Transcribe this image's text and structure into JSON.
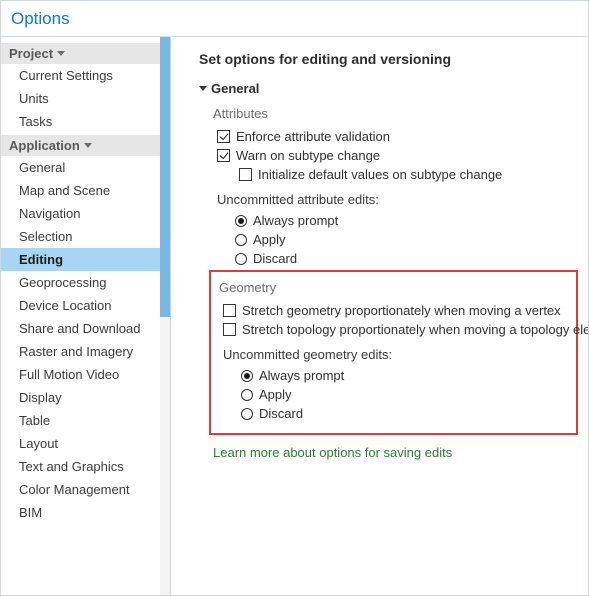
{
  "window": {
    "title": "Options"
  },
  "sidebar": {
    "groups": [
      {
        "label": "Project",
        "items": [
          "Current Settings",
          "Units",
          "Tasks"
        ]
      },
      {
        "label": "Application",
        "items": [
          "General",
          "Map and Scene",
          "Navigation",
          "Selection",
          "Editing",
          "Geoprocessing",
          "Device Location",
          "Share and Download",
          "Raster and Imagery",
          "Full Motion Video",
          "Display",
          "Table",
          "Layout",
          "Text and Graphics",
          "Color Management",
          "BIM"
        ],
        "selected": "Editing"
      }
    ]
  },
  "content": {
    "heading": "Set options for editing and versioning",
    "section": "General",
    "attributes": {
      "label": "Attributes",
      "enforce": "Enforce attribute validation",
      "warn": "Warn on subtype change",
      "init": "Initialize default values on subtype change",
      "uncommitted_label": "Uncommitted attribute edits:",
      "opt_prompt": "Always prompt",
      "opt_apply": "Apply",
      "opt_discard": "Discard"
    },
    "geometry": {
      "label": "Geometry",
      "stretch_geom": "Stretch geometry proportionately when moving a vertex",
      "stretch_topo": "Stretch topology proportionately when moving a topology eleme",
      "uncommitted_label": "Uncommitted geometry edits:",
      "opt_prompt": "Always prompt",
      "opt_apply": "Apply",
      "opt_discard": "Discard"
    },
    "link": "Learn more about options for saving edits"
  }
}
